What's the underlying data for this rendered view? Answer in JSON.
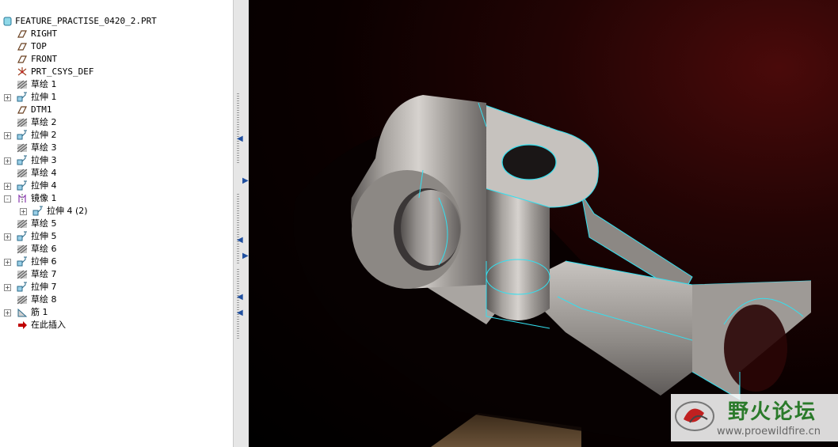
{
  "model_tree": {
    "items": [
      {
        "label": "FEATURE_PRACTISE_0420_2.PRT",
        "icon": "part-icon",
        "indent": 0,
        "expander": ""
      },
      {
        "label": "RIGHT",
        "icon": "datum-plane-icon",
        "indent": 1,
        "expander": ""
      },
      {
        "label": "TOP",
        "icon": "datum-plane-icon",
        "indent": 1,
        "expander": ""
      },
      {
        "label": "FRONT",
        "icon": "datum-plane-icon",
        "indent": 1,
        "expander": ""
      },
      {
        "label": "PRT_CSYS_DEF",
        "icon": "csys-icon",
        "indent": 1,
        "expander": ""
      },
      {
        "label": "草绘 1",
        "icon": "sketch-icon",
        "indent": 1,
        "expander": ""
      },
      {
        "label": "拉伸 1",
        "icon": "extrude-icon",
        "indent": 1,
        "expander": "+"
      },
      {
        "label": "DTM1",
        "icon": "datum-plane-icon",
        "indent": 1,
        "expander": ""
      },
      {
        "label": "草绘 2",
        "icon": "sketch-icon",
        "indent": 1,
        "expander": ""
      },
      {
        "label": "拉伸 2",
        "icon": "extrude-icon",
        "indent": 1,
        "expander": "+"
      },
      {
        "label": "草绘 3",
        "icon": "sketch-icon",
        "indent": 1,
        "expander": ""
      },
      {
        "label": "拉伸 3",
        "icon": "extrude-icon",
        "indent": 1,
        "expander": "+"
      },
      {
        "label": "草绘 4",
        "icon": "sketch-icon",
        "indent": 1,
        "expander": ""
      },
      {
        "label": "拉伸 4",
        "icon": "extrude-icon",
        "indent": 1,
        "expander": "+"
      },
      {
        "label": "镜像 1",
        "icon": "mirror-icon",
        "indent": 1,
        "expander": "-"
      },
      {
        "label": "拉伸 4 (2)",
        "icon": "extrude-icon",
        "indent": 2,
        "expander": "+"
      },
      {
        "label": "草绘 5",
        "icon": "sketch-icon",
        "indent": 1,
        "expander": ""
      },
      {
        "label": "拉伸 5",
        "icon": "extrude-icon",
        "indent": 1,
        "expander": "+"
      },
      {
        "label": "草绘 6",
        "icon": "sketch-icon",
        "indent": 1,
        "expander": ""
      },
      {
        "label": "拉伸 6",
        "icon": "extrude-icon",
        "indent": 1,
        "expander": "+"
      },
      {
        "label": "草绘 7",
        "icon": "sketch-icon",
        "indent": 1,
        "expander": ""
      },
      {
        "label": "拉伸 7",
        "icon": "extrude-icon",
        "indent": 1,
        "expander": "+"
      },
      {
        "label": "草绘 8",
        "icon": "sketch-icon",
        "indent": 1,
        "expander": ""
      },
      {
        "label": "筋 1",
        "icon": "rib-icon",
        "indent": 1,
        "expander": "+"
      },
      {
        "label": "在此插入",
        "icon": "insert-here-arrow-icon",
        "indent": 1,
        "expander": ""
      }
    ]
  },
  "watermark": {
    "title": "野火论坛",
    "url": "www.proewildfire.cn"
  },
  "colors": {
    "edge_highlight": "#33e0f0",
    "tree_background": "#ffffff",
    "insert_arrow": "#c00000"
  }
}
